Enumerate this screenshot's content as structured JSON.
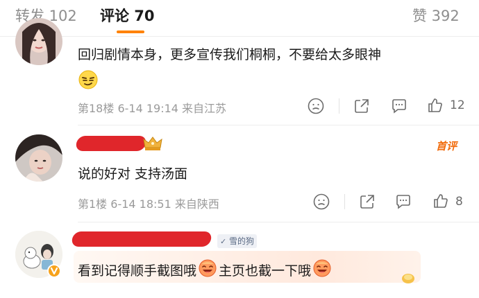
{
  "tabs": [
    {
      "label": "转发 102",
      "active": false
    },
    {
      "label": "评论 70",
      "active": true
    },
    {
      "label": "赞 392",
      "active": false
    }
  ],
  "colors": {
    "accent": "#ff8200",
    "redaction": "#e0262b",
    "first_badge": "#f16b0c"
  },
  "comments": [
    {
      "text": "回归剧情本身，更多宣传我们桐桐，不要给太多眼神",
      "meta": "第18楼 6-14 19:14 来自江苏",
      "like_count": "12",
      "emoji": "smug-face-emoji"
    },
    {
      "text": "说的好对 支持汤面",
      "meta": "第1楼 6-14 18:51 来自陕西",
      "like_count": "8",
      "badge": "首评"
    },
    {
      "text_a": "看到记得顺手截图哦",
      "text_b": "主页也截一下哦",
      "tag": "雪的狗",
      "emoji": "lol-face-emoji"
    }
  ]
}
